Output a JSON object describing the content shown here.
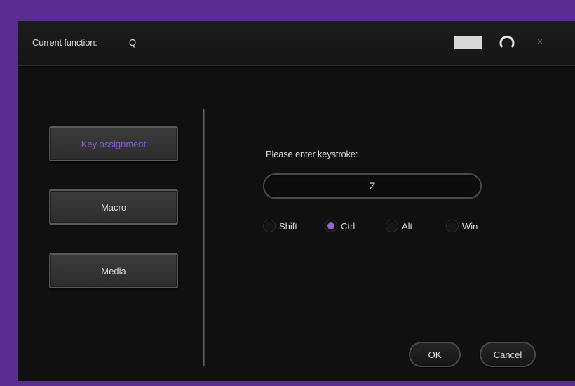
{
  "titlebar": {
    "label": "Current function:",
    "value": "Q",
    "swatch_color": "#d6d8d8",
    "refresh_icon": "refresh-icon",
    "close_label": "×"
  },
  "sidebar": {
    "items": [
      {
        "label": "Key assignment",
        "active": true
      },
      {
        "label": "Macro",
        "active": false
      },
      {
        "label": "Media",
        "active": false
      }
    ]
  },
  "main": {
    "prompt": "Please enter keystroke:",
    "keystroke_value": "Z",
    "modifiers": [
      {
        "label": "Shift",
        "checked": false
      },
      {
        "label": "Ctrl",
        "checked": true
      },
      {
        "label": "Alt",
        "checked": false
      },
      {
        "label": "Win",
        "checked": false
      }
    ]
  },
  "footer": {
    "ok_label": "OK",
    "cancel_label": "Cancel"
  },
  "colors": {
    "accent": "#8c63d8",
    "frame": "#5a2d91",
    "window_bg": "#101010"
  }
}
